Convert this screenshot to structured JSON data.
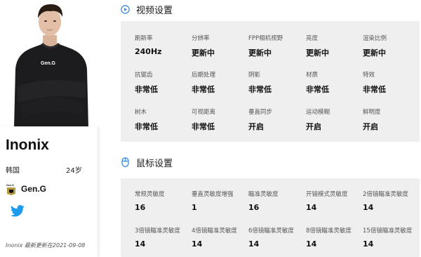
{
  "player": {
    "name": "Inonix",
    "country": "韩国",
    "age": "24岁",
    "team": "Gen.G",
    "team_logo_text": "Gen.G",
    "shirt_text": "Gen.G",
    "updated": "Inonix 最新更新在2021-09-08"
  },
  "video": {
    "title": "视频设置",
    "icon": "play-circle-icon",
    "items": [
      {
        "label": "刷新率",
        "value": "240Hz"
      },
      {
        "label": "分辨率",
        "value": "更新中"
      },
      {
        "label": "FPP相机视野",
        "value": "更新中"
      },
      {
        "label": "亮度",
        "value": "更新中"
      },
      {
        "label": "渲染比例",
        "value": "更新中"
      },
      {
        "label": "抗锯齿",
        "value": "非常低"
      },
      {
        "label": "后期处理",
        "value": "非常低"
      },
      {
        "label": "阴影",
        "value": "非常低"
      },
      {
        "label": "材质",
        "value": "非常低"
      },
      {
        "label": "特效",
        "value": "非常低"
      },
      {
        "label": "树木",
        "value": "非常低"
      },
      {
        "label": "可视距离",
        "value": "非常低"
      },
      {
        "label": "垂直同步",
        "value": "开启"
      },
      {
        "label": "运动模糊",
        "value": "开启"
      },
      {
        "label": "鲜明度",
        "value": "开启"
      }
    ]
  },
  "mouse": {
    "title": "鼠标设置",
    "icon": "mouse-icon",
    "items": [
      {
        "label": "常规灵敏度",
        "value": "16"
      },
      {
        "label": "垂直灵敏度增强",
        "value": "1"
      },
      {
        "label": "瞄准灵敏度",
        "value": "16"
      },
      {
        "label": "开镜模式灵敏度",
        "value": "14"
      },
      {
        "label": "2倍镜瞄准灵敏度",
        "value": "14"
      },
      {
        "label": "3倍镜瞄准灵敏度",
        "value": "14"
      },
      {
        "label": "4倍镜瞄准灵敏度",
        "value": "14"
      },
      {
        "label": "6倍镜瞄准灵敏度",
        "value": "14"
      },
      {
        "label": "8倍镜瞄准灵敏度",
        "value": "14"
      },
      {
        "label": "15倍镜瞄准灵敏度",
        "value": "14"
      }
    ]
  },
  "colors": {
    "accent": "#3b8be0",
    "panel": "#efefef",
    "twitter": "#1d9bf0"
  }
}
